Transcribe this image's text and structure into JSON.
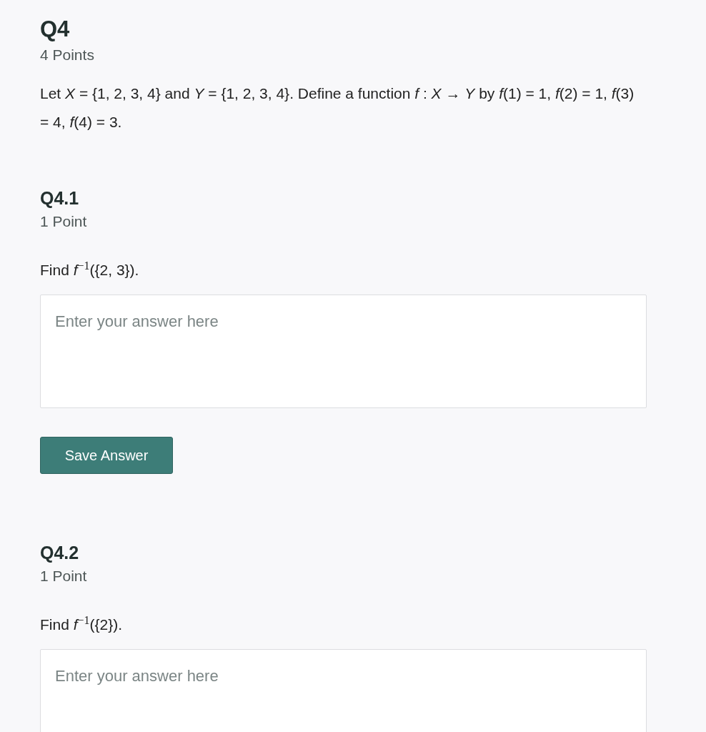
{
  "question": {
    "title": "Q4",
    "points": "4 Points",
    "prompt": "Let *X* = {1, 2, 3, 4} and *Y* = {1, 2, 3, 4}. Define a function *f* : *X* → *Y* by *f*(1) = 1, *f*(2) = 1, *f*(3) = 4, *f*(4) = 3."
  },
  "subquestions": [
    {
      "title": "Q4.1",
      "points": "1 Point",
      "prompt": "Find *f*$^{−1}$({2, 3}).",
      "answer": {
        "placeholder": "Enter your answer here"
      },
      "save_button": "Save Answer"
    },
    {
      "title": "Q4.2",
      "points": "1 Point",
      "prompt": "Find *f*$^{−1}$({2}).",
      "answer": {
        "placeholder": "Enter your answer here"
      }
    }
  ]
}
